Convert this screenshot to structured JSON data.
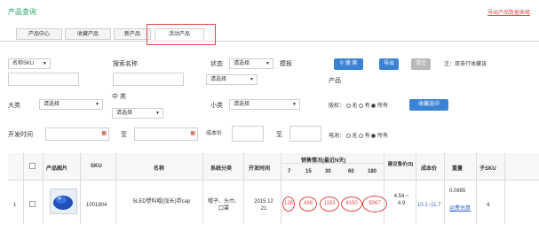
{
  "page": {
    "title": "产品查询",
    "top_link": "导出产品数据表格"
  },
  "tabs": [
    {
      "label": "产品中心"
    },
    {
      "label": "收藏产品"
    },
    {
      "label": "新产品"
    },
    {
      "label": "活动产品"
    }
  ],
  "filters": {
    "sku_select": "名称SKU",
    "row1_label_a": "搜索名称",
    "status_label": "状态",
    "status_select": "请选择",
    "template_label": "模板",
    "status_select2": "请选择",
    "product_label": "产品",
    "search_btn": "搜 索",
    "export_btn": "导出",
    "clear_btn": "清空",
    "hint": "注：双击行收藏该",
    "big_cat_label": "大类",
    "big_cat_select": "请选择",
    "mid_cat_label": "中 类",
    "mid_cat_select": "请选择",
    "small_cat_label": "小类",
    "small_cat_select": "请选择",
    "rights_label": "版权：",
    "rights_opt1": "无",
    "rights_opt2": "有",
    "rights_opt3": "所有",
    "fav_btn": "收藏选中",
    "dev_time_label": "开发时间",
    "to_label": "至",
    "cost_label": "成本价",
    "cost_to_label": "至",
    "battery_label": "电池：",
    "battery_opt1": "无",
    "battery_opt2": "有",
    "battery_opt3": "所有"
  },
  "table": {
    "headers": {
      "image": "产品图片",
      "sku": "SKU",
      "name": "名称",
      "category": "系统分类",
      "dev_time": "开发时间",
      "sales_group": "销售情况(最近N天)",
      "d7": "7",
      "d15": "15",
      "d30": "30",
      "d60": "60",
      "d180": "180",
      "profit": "建议售价($)",
      "cost": "成本价",
      "weight": "重量",
      "sub_sku": "子SKU"
    },
    "rows": [
      {
        "index": "1",
        "sku": "1001904",
        "name": "5LED塑料帽(加长)带cap",
        "category": "帽子、头巾、口罩",
        "dev_time": "2015 12 21",
        "s7": "126",
        "s15": "438",
        "s30": "1153",
        "s60": "4150",
        "s180": "5067",
        "profit": "4.54 ~ 4.9",
        "cost": "10.1~11.7",
        "weight": "0.0865",
        "weight_link": "运费估算",
        "sub_sku": "4"
      }
    ]
  }
}
